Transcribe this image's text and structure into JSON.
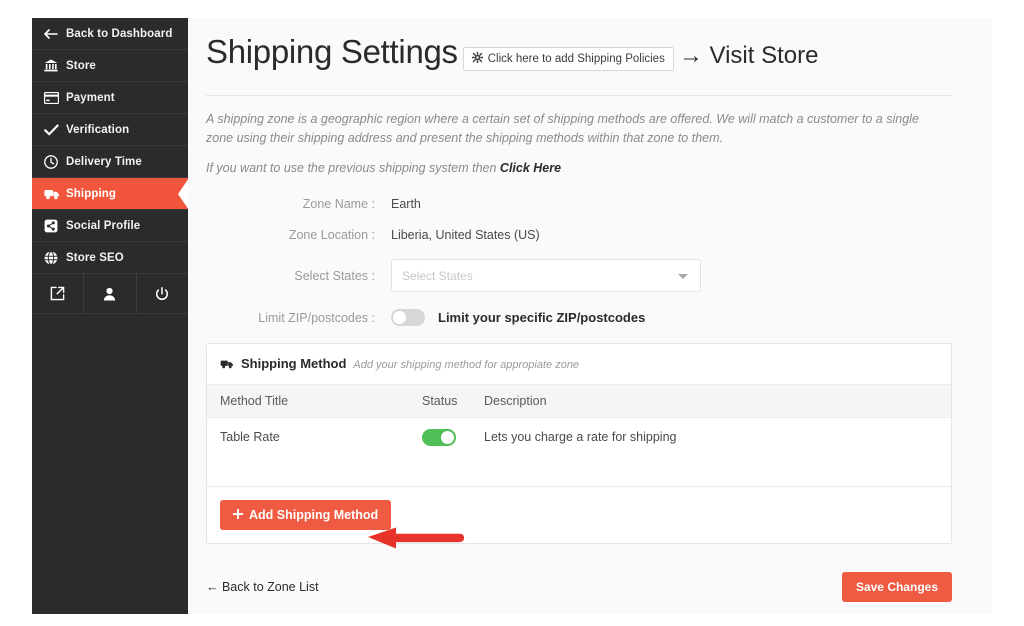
{
  "sidebar": {
    "items": [
      {
        "label": "Back to Dashboard",
        "icon": "arrow-left-icon",
        "active": false
      },
      {
        "label": "Store",
        "icon": "bank-icon",
        "active": false
      },
      {
        "label": "Payment",
        "icon": "credit-card-icon",
        "active": false
      },
      {
        "label": "Verification",
        "icon": "check-icon",
        "active": false
      },
      {
        "label": "Delivery Time",
        "icon": "clock-icon",
        "active": false
      },
      {
        "label": "Shipping",
        "icon": "truck-icon",
        "active": true
      },
      {
        "label": "Social Profile",
        "icon": "share-icon",
        "active": false
      },
      {
        "label": "Store SEO",
        "icon": "globe-icon",
        "active": false
      }
    ],
    "bottom_icons": [
      "external-link-icon",
      "user-icon",
      "power-icon"
    ],
    "active_color": "#f1563c",
    "background": "#2b2b2b"
  },
  "header": {
    "title": "Shipping Settings",
    "policy_button": "Click here to add Shipping Policies",
    "policy_button_icon": "gear-icon",
    "visit_store": "→ Visit Store"
  },
  "intro": {
    "paragraph": "A shipping zone is a geographic region where a certain set of shipping methods are offered. We will match a customer to a single zone using their shipping address and present the shipping methods within that zone to them.",
    "previous_prefix": "If you want to use the previous shipping system then ",
    "previous_link": "Click Here"
  },
  "form": {
    "zone_name_label": "Zone Name :",
    "zone_name_value": "Earth",
    "zone_location_label": "Zone Location :",
    "zone_location_value": "Liberia, United States (US)",
    "select_states_label": "Select States :",
    "select_states_placeholder": "Select States",
    "select_states_value": "",
    "limit_zip_label": "Limit ZIP/postcodes :",
    "limit_zip_toggle_on": false,
    "limit_zip_text": "Limit your specific ZIP/postcodes"
  },
  "shipping_method_card": {
    "title": "Shipping Method",
    "title_icon": "truck-icon",
    "subtitle": "Add your shipping method for appropiate zone",
    "columns": [
      "Method Title",
      "Status",
      "Description"
    ],
    "rows": [
      {
        "title": "Table Rate",
        "status_on": true,
        "description": "Lets you charge a rate for shipping"
      }
    ],
    "add_button": "Add Shipping Method",
    "add_button_icon": "plus-icon",
    "accent_color": "#ef5b42",
    "toggle_on_color": "#4fbf56"
  },
  "footer": {
    "back_link": "← Back to Zone List",
    "save_button": "Save Changes"
  },
  "annotation": {
    "arrow_color": "#e8332a",
    "arrow_direction": "left",
    "points_to": "Add Shipping Method"
  }
}
